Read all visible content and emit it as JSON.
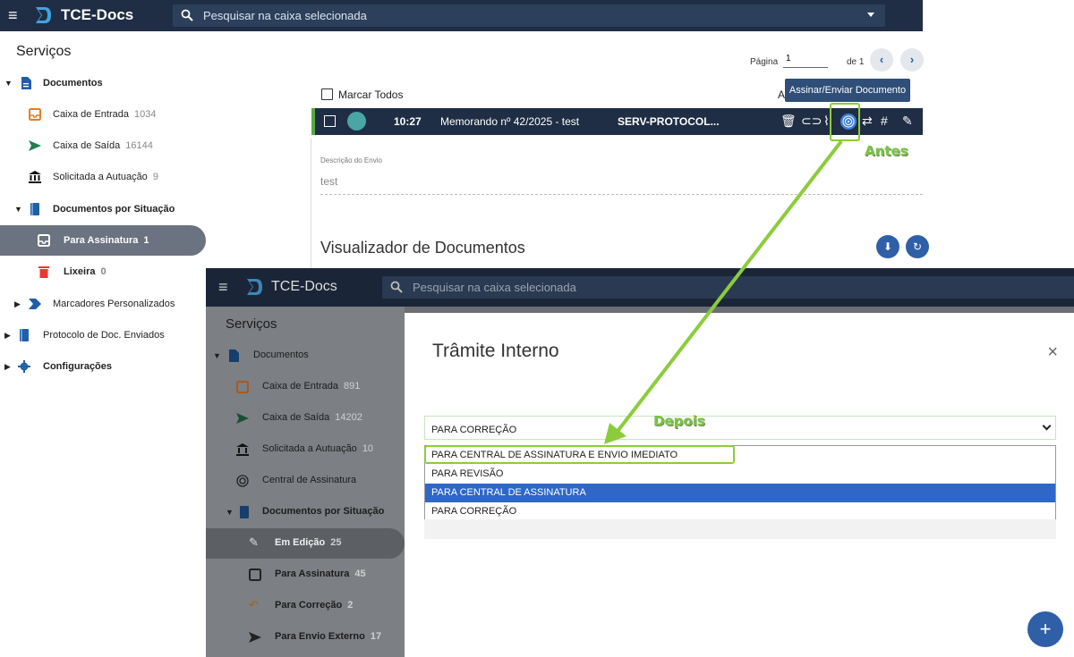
{
  "top": {
    "brand": "TCE-Docs",
    "search_placeholder": "Pesquisar na caixa selecionada"
  },
  "sidebar": {
    "title": "Serviços",
    "items": [
      {
        "label": "Documentos",
        "count": ""
      },
      {
        "label": "Caixa de Entrada",
        "count": "1034"
      },
      {
        "label": "Caixa de Saída",
        "count": "16144"
      },
      {
        "label": "Solicitada a Autuação",
        "count": "9"
      },
      {
        "label": "Documentos por Situação",
        "count": ""
      },
      {
        "label": "Para Assinatura",
        "count": "1"
      },
      {
        "label": "Lixeira",
        "count": "0"
      },
      {
        "label": "Marcadores Personalizados",
        "count": ""
      },
      {
        "label": "Protocolo de Doc. Enviados",
        "count": ""
      },
      {
        "label": "Configurações",
        "count": ""
      }
    ]
  },
  "pager": {
    "label": "Página",
    "value": "1",
    "of": "de 1",
    "prev": "‹",
    "next": "›"
  },
  "tooltip": "Assinar/Enviar Documento",
  "list": {
    "select_all": "Marcar Todos",
    "col_a": "A"
  },
  "doc": {
    "time": "10:27",
    "title": "Memorando nº 42/2025 - test",
    "sender": "SERV-PROTOCOL..."
  },
  "desc": {
    "label": "Descrição do Envio",
    "value": "test"
  },
  "viewer": {
    "title": "Visualizador de Documentos"
  },
  "annotations": {
    "before": "Antes",
    "after": "Depois"
  },
  "shot2": {
    "brand": "TCE-Docs",
    "search_placeholder": "Pesquisar na caixa selecionada",
    "sidebar_title": "Serviços",
    "items": [
      {
        "label": "Documentos",
        "count": ""
      },
      {
        "label": "Caixa de Entrada",
        "count": "891"
      },
      {
        "label": "Caixa de Saída",
        "count": "14202"
      },
      {
        "label": "Solicitada a Autuação",
        "count": "10"
      },
      {
        "label": "Central de Assinatura",
        "count": ""
      },
      {
        "label": "Documentos por Situação",
        "count": ""
      },
      {
        "label": "Em Edição",
        "count": "25"
      },
      {
        "label": "Para Assinatura",
        "count": "45"
      },
      {
        "label": "Para Correção",
        "count": "2"
      },
      {
        "label": "Para Envio Externo",
        "count": "17"
      }
    ],
    "modal": {
      "title": "Trâmite Interno",
      "close": "×",
      "selected": "PARA CORREÇÃO",
      "options": [
        "PARA CENTRAL DE ASSINATURA E ENVIO IMEDIATO",
        "PARA REVISÃO",
        "PARA CENTRAL DE ASSINATURA",
        "PARA CORREÇÃO"
      ],
      "fab": "+"
    }
  },
  "colors": {
    "topbar": "#1f2e44",
    "accent": "#2f5fa7",
    "highlight": "#8ccc3c",
    "option_selected": "#2f67c9"
  }
}
